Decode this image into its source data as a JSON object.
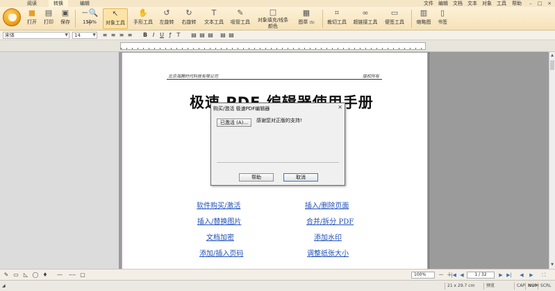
{
  "tabs": [
    "阅读",
    "转换",
    "编辑"
  ],
  "menu": [
    "文件",
    "编辑",
    "文档",
    "文本",
    "对象",
    "工具",
    "帮助"
  ],
  "window_controls": [
    "–",
    "□",
    "×"
  ],
  "toolbar": {
    "open": "打开",
    "print": "打印",
    "save": "保存",
    "zoom_value": "150%",
    "select_tool": "对象工具",
    "hand_tool": "手形工具",
    "rotate_left": "左旋转",
    "rotate_right": "右旋转",
    "text_tool": "文本工具",
    "eyedropper": "吸管工具",
    "fill_stroke_line1": "对象填充/线条",
    "fill_stroke_line2": "颜色",
    "shape": "图章",
    "shape_sub": "(S)",
    "crop": "裁切工具",
    "link": "超链接工具",
    "note": "便签工具",
    "thumbnail": "缩略图",
    "bookmark": "书签"
  },
  "format": {
    "font": "宋体",
    "size": "14",
    "bold": "B",
    "italic": "I",
    "underline": "U"
  },
  "document": {
    "header_left": "北京海腾时代科技有限公司",
    "header_right": "版权所有",
    "title": "极速 PDF 编辑器使用手册",
    "links": [
      "软件购买/激活",
      "插入/删除页面",
      "插入/替换图片",
      "合并/拆分 PDF",
      "文档加密",
      "添加水印",
      "添加/插入页码",
      "调整纸张大小"
    ]
  },
  "dialog": {
    "title": "购买/激活 极速PDF编辑器",
    "close": "×",
    "activated_button": "已激活 (A)...",
    "message": "感谢您对正版的支持!",
    "help_button": "帮助",
    "cancel_button": "取消"
  },
  "bottom": {
    "zoom": "100%",
    "page": "1 / 32"
  },
  "status": {
    "size": "21 x 29.7 cm",
    "mode": "预览",
    "cap": "CAP",
    "num": "NUM",
    "scrl": "SCRL"
  },
  "colors": {
    "ribbon": "#f6e2b7",
    "link": "#1f4fb8",
    "workspace": "#9b9b9b"
  }
}
